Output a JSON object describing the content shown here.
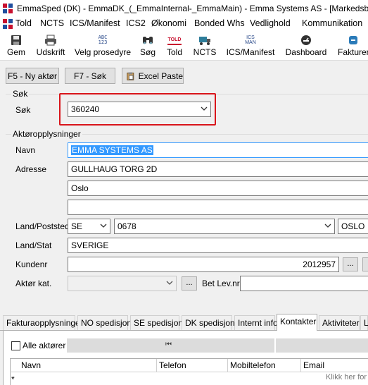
{
  "window": {
    "title": "EmmaSped (DK) - EmmaDK_(_EmmaInternal-_EmmaMain) - Emma Systems AS - [Markedsbase"
  },
  "menu": [
    "Told",
    "NCTS",
    "ICS/Manifest",
    "ICS2",
    "Økonomi",
    "Bonded Whs",
    "Vedlighold",
    "Kommunikation"
  ],
  "toolbar": {
    "gem": "Gem",
    "udskrift": "Udskrift",
    "velg": "Velg prosedyre",
    "velg_icon_text": "ABC\n123",
    "sog": "Søg",
    "told": "Told",
    "told_icon_text": "TOLD",
    "ncts": "NCTS",
    "ics": "ICS/Manifest",
    "ics_icon_text": "ICS\nMAN",
    "dashboard": "Dashboard",
    "fakturer": "Fakturer"
  },
  "actions": {
    "new_actor": "F5 - Ny aktør",
    "search": "F7 - Søk",
    "excel_paste": "Excel Paste"
  },
  "search_group": {
    "title": "Søk",
    "label": "Søk",
    "value": "360240"
  },
  "actor_group": {
    "title": "Aktøropplysninger",
    "name_label": "Navn",
    "name_value": "EMMA SYSTEMS AS",
    "address_label": "Adresse",
    "address1": "GULLHAUG TORG 2D",
    "address2": "Oslo",
    "address3": "",
    "land_label": "Land/Poststed",
    "country_code": "SE",
    "postcode": "0678",
    "city": "OSLO",
    "land_stat_label": "Land/Stat",
    "land_stat_value": "SVERIGE",
    "customer_no_label": "Kundenr",
    "customer_no_value": "2012957",
    "actor_cat_label": "Aktør kat.",
    "actor_cat_value": "",
    "bet_label": "Bet Lev.nr",
    "bet_value": "",
    "ellipsis": "..."
  },
  "tabs": [
    "Fakturaopplysninger",
    "NO spedisjon",
    "SE spedisjon",
    "DK spedisjon",
    "Internt info",
    "Kontakter",
    "Aktiviteter",
    "L"
  ],
  "active_tab": "Kontakter",
  "contacts": {
    "all_actors_label": "Alle aktører",
    "all_actors_checked": false,
    "nav_first": "⏮",
    "columns": [
      "Navn",
      "Telefon",
      "Mobiltelefon",
      "Email"
    ],
    "new_row_marker": "*",
    "add_hint": "Klikk her for å"
  },
  "colors": {
    "highlight": "#d9151b",
    "selection": "#3399ff",
    "tab_active_bg": "#ffffff"
  }
}
